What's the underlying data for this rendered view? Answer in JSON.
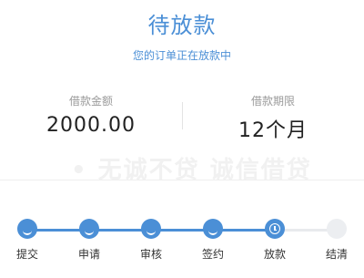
{
  "status": {
    "title": "待放款",
    "subtitle": "您的订单正在放款中"
  },
  "loan": {
    "amount_label": "借款金额",
    "amount_value": "2000.00",
    "term_label": "借款期限",
    "term_value": "12个月"
  },
  "colors": {
    "accent": "#4b8fd6",
    "pending": "#eceef1"
  },
  "progress": {
    "current_step": 5,
    "steps": [
      {
        "label": "提交",
        "state": "done",
        "icon": "check-icon"
      },
      {
        "label": "申请",
        "state": "done",
        "icon": "check-icon"
      },
      {
        "label": "审核",
        "state": "done",
        "icon": "check-icon"
      },
      {
        "label": "签约",
        "state": "done",
        "icon": "check-icon"
      },
      {
        "label": "放款",
        "state": "current",
        "icon": "clock-icon"
      },
      {
        "label": "结清",
        "state": "pending",
        "icon": "none"
      }
    ]
  }
}
